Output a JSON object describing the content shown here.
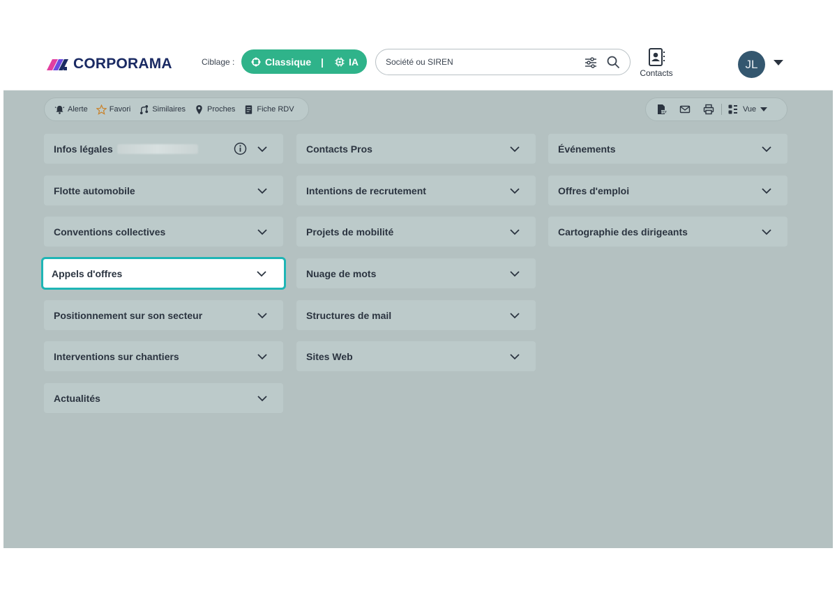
{
  "brand": {
    "name": "CORPORAMA"
  },
  "header": {
    "ciblage_label": "Ciblage :",
    "mode_classique": "Classique",
    "mode_separator": "|",
    "mode_ia": "IA",
    "search_placeholder": "Société ou SIREN",
    "contacts_label": "Contacts",
    "avatar_initials": "JL"
  },
  "toolbar": {
    "left": [
      {
        "label": "Alerte",
        "icon": "bell-icon"
      },
      {
        "label": "Favori",
        "icon": "star-icon"
      },
      {
        "label": "Similaires",
        "icon": "branch-icon"
      },
      {
        "label": "Proches",
        "icon": "map-pin-icon"
      },
      {
        "label": "Fiche RDV",
        "icon": "document-icon"
      }
    ],
    "right": {
      "pdf_icon": "pdf-icon",
      "mail_icon": "mail-icon",
      "print_icon": "printer-icon",
      "view_label": "Vue"
    }
  },
  "columns": [
    [
      {
        "title": "Infos légales",
        "has_info": true,
        "redacted": true
      },
      {
        "title": "Flotte automobile"
      },
      {
        "title": "Conventions collectives"
      },
      {
        "title": "Appels d'offres",
        "active": true
      },
      {
        "title": "Positionnement sur son secteur"
      },
      {
        "title": "Interventions sur chantiers"
      },
      {
        "title": "Actualités"
      }
    ],
    [
      {
        "title": "Contacts Pros"
      },
      {
        "title": "Intentions de recrutement"
      },
      {
        "title": "Projets de mobilité"
      },
      {
        "title": "Nuage de mots"
      },
      {
        "title": "Structures de mail"
      },
      {
        "title": "Sites Web"
      }
    ],
    [
      {
        "title": "Événements"
      },
      {
        "title": "Offres d'emploi"
      },
      {
        "title": "Cartographie des dirigeants"
      }
    ]
  ],
  "colors": {
    "accent_green": "#2fb38a",
    "brand_navy": "#1a2a63",
    "active_outline": "#1fb5b5",
    "panel_bg": "#b4c1c1",
    "card_bg": "#bccaca"
  }
}
